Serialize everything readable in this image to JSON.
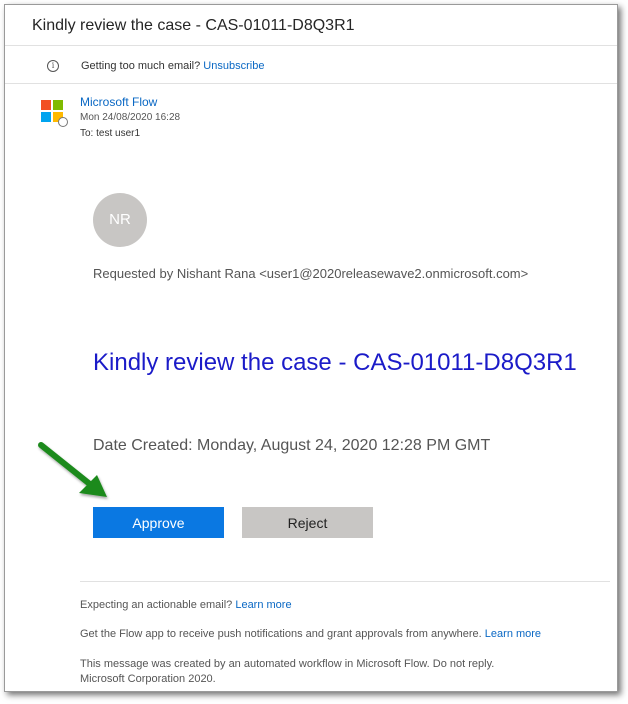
{
  "subject": "Kindly review the case - CAS-01011-D8Q3R1",
  "notice": {
    "icon": "info-icon",
    "text": "Getting too much email?",
    "link": "Unsubscribe"
  },
  "header": {
    "sender_name": "Microsoft Flow",
    "date": "Mon 24/08/2020 16:28",
    "to_label": "To:",
    "to_value": "test user1",
    "logo_colors": [
      "#f25022",
      "#7fba00",
      "#00a4ef",
      "#ffb900"
    ]
  },
  "body": {
    "avatar_initials": "NR",
    "requested_by": "Requested by Nishant Rana <user1@2020releasewave2.onmicrosoft.com>",
    "title": "Kindly review the case - CAS-01011-D8Q3R1",
    "date_created": "Date Created: Monday, August 24, 2020 12:28 PM GMT",
    "approve_label": "Approve",
    "reject_label": "Reject",
    "arrow_color": "#1f8a1f"
  },
  "footer": {
    "actionable_text": "Expecting an actionable email?",
    "actionable_link": "Learn more",
    "app_text": "Get the Flow app to receive push notifications and grant approvals from anywhere.",
    "app_link": "Learn more",
    "automated_line1": "This message was created by an automated workflow in Microsoft Flow. Do not reply.",
    "automated_line2": "Microsoft Corporation 2020."
  }
}
